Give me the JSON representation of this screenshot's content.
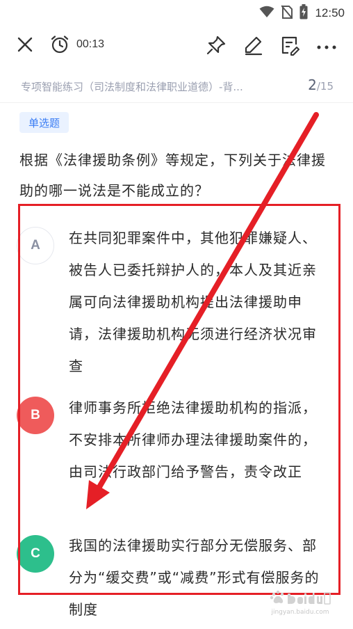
{
  "status_bar": {
    "time": "12:50",
    "icons": [
      "wifi-icon",
      "no-sim-icon",
      "battery-charging-icon"
    ]
  },
  "toolbar": {
    "timer": "00:13",
    "icons": [
      "close-icon",
      "alarm-clock-icon",
      "pin-icon",
      "pen-edit-icon",
      "note-edit-icon",
      "more-icon"
    ]
  },
  "header": {
    "breadcrumb": "专项智能练习（司法制度和法律职业道德）-背...",
    "page_current": "2",
    "page_separator": "/",
    "page_total": "15"
  },
  "question": {
    "type_tag": "单选题",
    "stem": "根据《法律援助条例》等规定，下列关于法律援助的哪一说法是不能成立的？"
  },
  "options": [
    {
      "letter": "A",
      "text": "在共同犯罪案件中，其他犯罪嫌疑人、被告人已委托辩护人的，本人及其近亲属可向法律援助机构提出法律援助申请，法律援助机构无须进行经济状况审查",
      "state": "unselected"
    },
    {
      "letter": "B",
      "text": "律师事务所拒绝法律援助机构的指派，不安排本所律师办理法律援助案件的，由司法行政部门给予警告，责令改正",
      "state": "selected-wrong"
    },
    {
      "letter": "C",
      "text": "我国的法律援助实行部分无偿服务、部分为“缓交费”或“减费”形式有偿服务的制度",
      "state": "correct"
    }
  ],
  "annotation": {
    "color": "#e51f26"
  },
  "watermark": {
    "line1": "jingyan.baidu.com"
  },
  "colors": {
    "accent_blue": "#3b7df4",
    "option_wrong": "#ef5b5b",
    "option_correct": "#2dbf8c"
  }
}
